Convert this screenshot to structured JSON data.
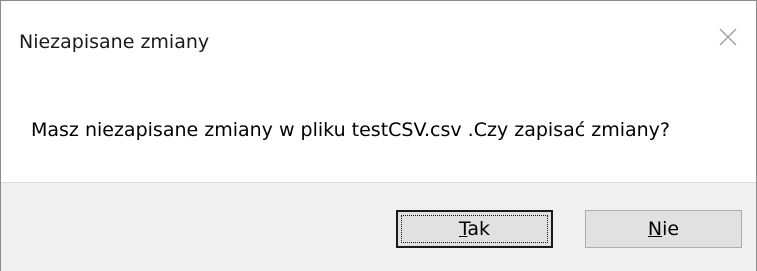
{
  "dialog": {
    "title": "Niezapisane zmiany",
    "message": "Masz niezapisane zmiany w pliku testCSV.csv .Czy zapisać zmiany?",
    "close_icon": "close-icon",
    "buttons": {
      "yes": {
        "mnemonic": "T",
        "rest": "ak"
      },
      "no": {
        "mnemonic": "N",
        "rest": "ie"
      }
    }
  },
  "colors": {
    "footer_bg": "#f0f0f0",
    "button_bg": "#e1e1e1",
    "border": "#8a8a8a"
  }
}
